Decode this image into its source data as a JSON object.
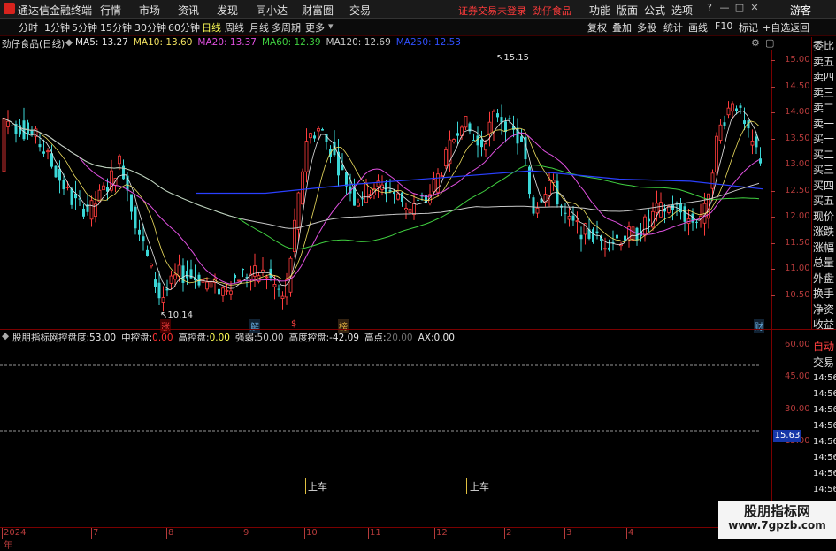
{
  "app": {
    "title": "通达信金融终端",
    "menu": [
      "行情",
      "市场",
      "资讯",
      "发现",
      "同小达",
      "财富圈",
      "交易"
    ],
    "notice": "证券交易未登录",
    "stock_name_top": "劲仔食品",
    "right_menu": [
      "功能",
      "版面",
      "公式",
      "选项"
    ],
    "guest": "游客"
  },
  "toolbar": {
    "timeframes": [
      "分时",
      "1分钟",
      "5分钟",
      "15分钟",
      "30分钟",
      "60分钟",
      "日线",
      "周线",
      "月线",
      "多周期",
      "更多"
    ],
    "active": "日线",
    "right": [
      "复权",
      "叠加",
      "多股",
      "统计",
      "画线",
      "F10",
      "标记",
      "+自选",
      "返回"
    ]
  },
  "chart": {
    "label": "劲仔食品(日线)",
    "ma": [
      {
        "name": "MA5",
        "value": "13.27",
        "color": "#e8e8e8"
      },
      {
        "name": "MA10",
        "value": "13.60",
        "color": "#f0e060"
      },
      {
        "name": "MA20",
        "value": "13.37",
        "color": "#e050e0"
      },
      {
        "name": "MA60",
        "value": "12.39",
        "color": "#40d040"
      },
      {
        "name": "MA120",
        "value": "12.69",
        "color": "#c8c8c8"
      },
      {
        "name": "MA250",
        "value": "12.53",
        "color": "#3050ff"
      }
    ],
    "y_ticks": [
      "15.00",
      "14.50",
      "14.00",
      "13.50",
      "13.00",
      "12.50",
      "12.00",
      "11.50",
      "11.00",
      "10.50"
    ],
    "high_label": "15.15",
    "low_label": "10.14",
    "markers": [
      "涨",
      "解",
      "$",
      "榜",
      "财"
    ]
  },
  "indicator": {
    "name": "股朋指标网",
    "items": [
      {
        "label": "控盘度:",
        "value": "53.00",
        "color": "#e8e8e8"
      },
      {
        "label": "中控盘:",
        "value": "0.00",
        "color": "#ff3030"
      },
      {
        "label": "高控盘:",
        "value": "0.00",
        "color": "#ffff55"
      },
      {
        "label": "强弱:",
        "value": "50.00",
        "color": "#c8c8c8"
      },
      {
        "label": "高度控盘:",
        "value": "-42.09",
        "color": "#e8e8e8"
      },
      {
        "label": "高点:",
        "value": "20.00",
        "color": "#707070"
      },
      {
        "label": "AX:",
        "value": "0.00",
        "color": "#e8e8e8"
      }
    ],
    "y_ticks": [
      "60.00",
      "45.00",
      "30.00",
      "15.00"
    ],
    "signal": "上车",
    "price_box": "15.63"
  },
  "sidebar": [
    "委比",
    "卖五",
    "卖四",
    "卖三",
    "卖二",
    "卖一",
    "买一",
    "买二",
    "买三",
    "买四",
    "买五",
    "现价",
    "涨跌",
    "涨幅",
    "总量",
    "外盘",
    "换手",
    "净资",
    "收益"
  ],
  "sidebar2": [
    "自动",
    "交易"
  ],
  "times": [
    "14:56",
    "14:56",
    "14:56",
    "14:56",
    "14:56",
    "14:56",
    "14:56",
    "14:56",
    "14:56"
  ],
  "x_labels": [
    "2024年",
    "7",
    "8",
    "9",
    "10",
    "11",
    "12",
    "2",
    "3",
    "4"
  ],
  "watermark": {
    "line1": "股朋指标网",
    "line2": "www.7gpzb.com"
  }
}
